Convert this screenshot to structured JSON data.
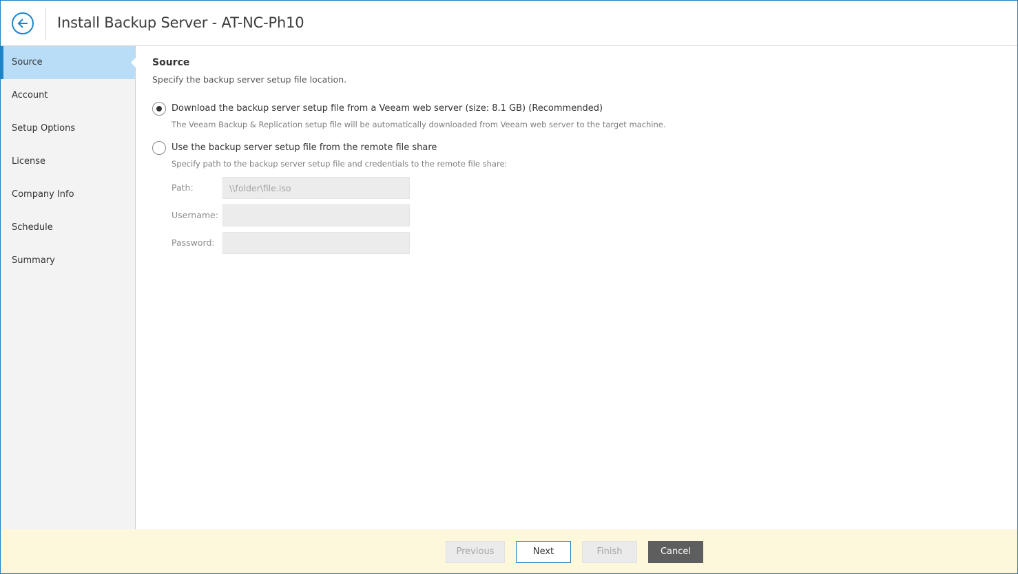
{
  "header": {
    "title": "Install Backup Server - AT-NC-Ph10",
    "back_icon": "arrow-left-circle-icon"
  },
  "sidebar": {
    "items": [
      {
        "label": "Source",
        "active": true
      },
      {
        "label": "Account",
        "active": false
      },
      {
        "label": "Setup Options",
        "active": false
      },
      {
        "label": "License",
        "active": false
      },
      {
        "label": "Company Info",
        "active": false
      },
      {
        "label": "Schedule",
        "active": false
      },
      {
        "label": "Summary",
        "active": false
      }
    ]
  },
  "main": {
    "title": "Source",
    "description": "Specify the backup server setup file location.",
    "options": [
      {
        "label": "Download the backup server setup file from a Veeam web server (size: 8.1 GB) (Recommended)",
        "hint": "The Veeam Backup & Replication setup file will be automatically downloaded from Veeam web server to the target machine.",
        "selected": true
      },
      {
        "label": "Use the backup server setup file from the remote file share",
        "hint": "Specify path to the backup server setup file and credentials to the remote file share:",
        "selected": false
      }
    ],
    "fields": {
      "path": {
        "label": "Path:",
        "placeholder": "\\\\folder\\file.iso",
        "value": ""
      },
      "username": {
        "label": "Username:",
        "placeholder": "",
        "value": ""
      },
      "password": {
        "label": "Password:",
        "placeholder": "",
        "value": ""
      }
    }
  },
  "footer": {
    "previous_label": "Previous",
    "next_label": "Next",
    "finish_label": "Finish",
    "cancel_label": "Cancel"
  },
  "colors": {
    "accent": "#1b7fc4",
    "active_nav_bg": "#b9dcf7",
    "footer_bg": "#fdf8dc",
    "cancel_bg": "#5e5e5e"
  }
}
